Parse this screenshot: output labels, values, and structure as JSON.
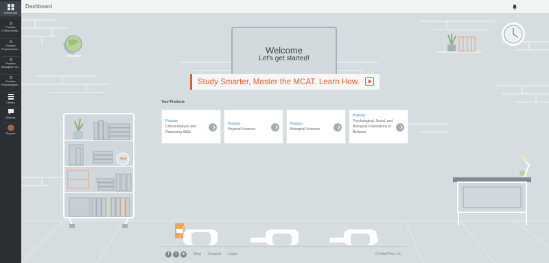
{
  "header": {
    "title": "Dashboard"
  },
  "sidebar": {
    "items": [
      {
        "line1": "Dashboard",
        "line2": ""
      },
      {
        "line1": "Practice",
        "line2": "Critical Analy..."
      },
      {
        "line1": "Practice",
        "line2": "Physical Scie..."
      },
      {
        "line1": "Practice",
        "line2": "Biological Sci..."
      },
      {
        "line1": "Practice",
        "line2": "Psychologica..."
      },
      {
        "line1": "Library",
        "line2": ""
      },
      {
        "line1": "Discuss",
        "line2": ""
      },
      {
        "line1": "Support",
        "line2": ""
      }
    ]
  },
  "welcome": {
    "title": "Welcome",
    "subtitle": "Let's get started!"
  },
  "cta": {
    "text": "Study Smarter, Master the MCAT. Learn How."
  },
  "products": {
    "label": "Your Products",
    "cards": [
      {
        "kind": "Practice",
        "name": "Critical Analysis and Reasoning Skills"
      },
      {
        "kind": "Practice",
        "name": "Physical Sciences"
      },
      {
        "kind": "Practice",
        "name": "Biological Sciences"
      },
      {
        "kind": "Practice",
        "name": "Psychological, Social, and Biological Foundations of Behavior"
      }
    ]
  },
  "footer": {
    "social": [
      "f",
      "t",
      "in"
    ],
    "links": [
      "Blog",
      "Support",
      "Legal"
    ],
    "copyright": "© AdaptPrep, Inc."
  },
  "colors": {
    "accent": "#e55a2b",
    "link": "#2c86c6",
    "sidebar": "#2b2f33",
    "wall": "#d5dde1"
  }
}
